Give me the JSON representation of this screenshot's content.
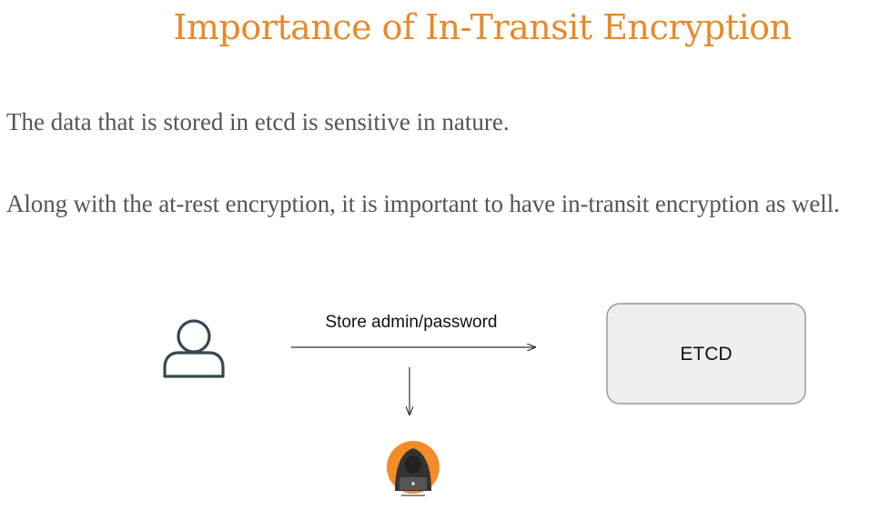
{
  "title": "Importance of In-Transit Encryption",
  "paragraphs": [
    "The data that is stored in etcd is sensitive in nature.",
    "Along with the at-rest encryption, it is important to have in-transit encryption as well."
  ],
  "diagram": {
    "user_icon": "user-icon",
    "hacker_icon": "hacker-icon",
    "arrow_label": "Store admin/password",
    "node_label": "ETCD",
    "colors": {
      "title": "#e8892b",
      "hacker_circle": "#f28c28",
      "node_fill": "#eeeeee",
      "node_stroke": "#999999"
    }
  }
}
